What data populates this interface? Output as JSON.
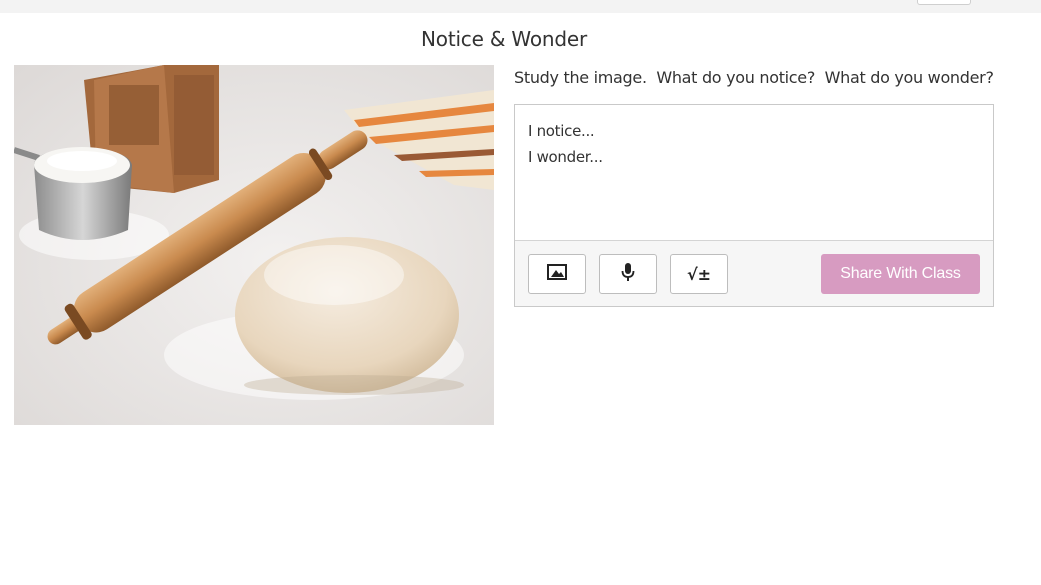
{
  "header": {
    "title": "Notice & Wonder"
  },
  "image": {
    "alt": ""
  },
  "prompt": {
    "text": "Study the image.  What do you notice?  What do you wonder?"
  },
  "editor": {
    "lines": [
      "I notice...",
      "I wonder..."
    ],
    "tools": {
      "image_icon": "image-icon",
      "mic_icon": "microphone-icon",
      "math_icon": "math-equation-icon",
      "math_glyph": "√±"
    },
    "share_label": "Share With Class",
    "share_color": "#d79bc1"
  }
}
